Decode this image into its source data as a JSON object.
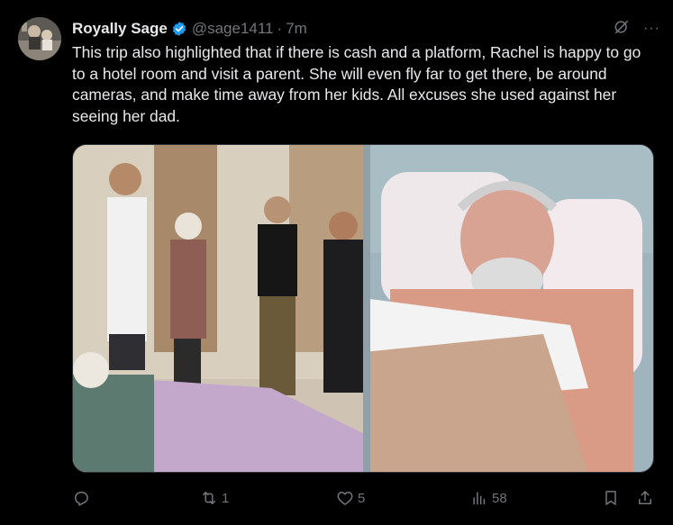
{
  "tweet": {
    "author_name": "Royally Sage",
    "handle": "@sage1411",
    "separator": "·",
    "time": "7m",
    "text": "This trip also highlighted that if there is cash and a platform, Rachel is happy to go to a hotel room and visit a parent. She will even fly far to get there, be around cameras, and make time away from her kids. All excuses she used against her seeing her dad.",
    "more_label": "···"
  },
  "actions": {
    "replies": "",
    "retweets": "1",
    "likes": "5",
    "views": "58"
  },
  "colors": {
    "background": "#000000",
    "text": "#e7e9ea",
    "muted": "#71767b",
    "verified": "#1d9bf0"
  },
  "icons": [
    "verified-badge-icon",
    "grok-icon",
    "more-icon",
    "reply-icon",
    "retweet-icon",
    "like-icon",
    "views-icon",
    "bookmark-icon",
    "share-icon"
  ]
}
